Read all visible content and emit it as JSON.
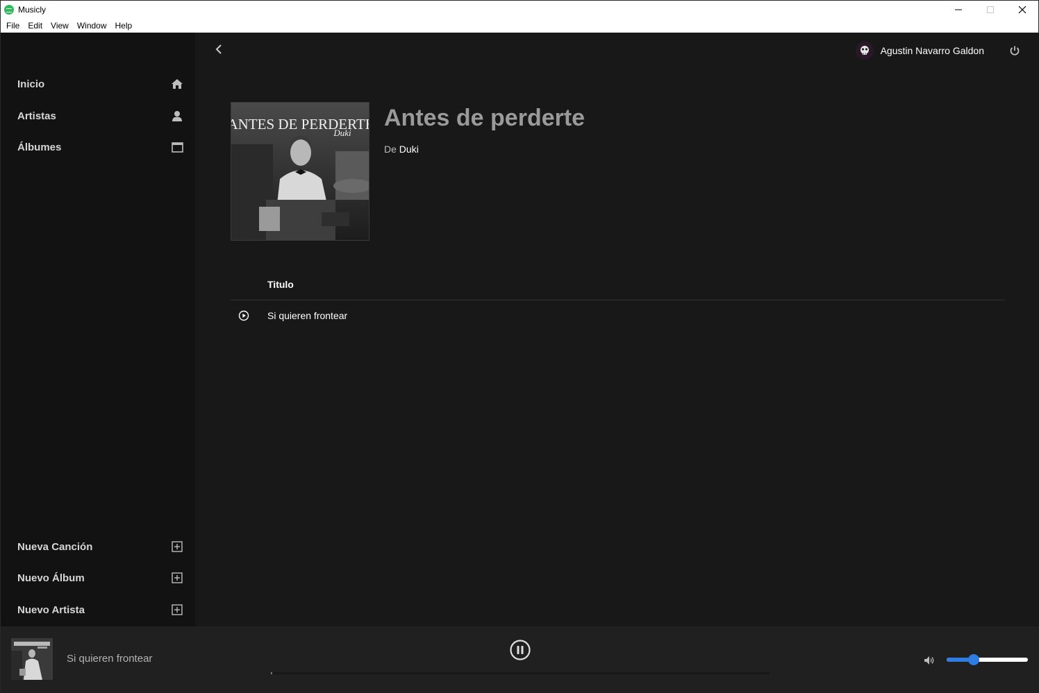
{
  "window": {
    "app_title": "Musicly",
    "controls": {
      "minimize_icon": "minimize-icon",
      "maximize_icon": "maximize-icon",
      "close_icon": "close-icon"
    }
  },
  "menubar": {
    "items": [
      "File",
      "Edit",
      "View",
      "Window",
      "Help"
    ]
  },
  "sidebar": {
    "nav": [
      {
        "label": "Inicio",
        "icon": "home-icon"
      },
      {
        "label": "Artistas",
        "icon": "user-icon"
      },
      {
        "label": "Álbumes",
        "icon": "album-icon"
      }
    ],
    "actions": [
      {
        "label": "Nueva Canción",
        "icon": "plus-square-icon"
      },
      {
        "label": "Nuevo Álbum",
        "icon": "plus-square-icon"
      },
      {
        "label": "Nuevo Artista",
        "icon": "plus-square-icon"
      }
    ]
  },
  "header": {
    "user_name": "Agustin Navarro Galdon",
    "avatar_icon": "avatar-icon",
    "power_icon": "power-icon",
    "back_icon": "chevron-left-icon"
  },
  "album": {
    "title": "Antes de perderte",
    "by_prefix": "De",
    "artist": "Duki",
    "cover_text_top": "“ANTES DE PERDERTE”",
    "cover_text_artist": "Duki"
  },
  "tracks": {
    "column_title": "Titulo",
    "items": [
      {
        "title": "Si quieren frontear"
      }
    ]
  },
  "player": {
    "now_playing": "Si quieren frontear",
    "state": "playing",
    "progress_fraction": 0.003,
    "volume_fraction": 0.33,
    "colors": {
      "accent": "#2f7de1"
    }
  }
}
